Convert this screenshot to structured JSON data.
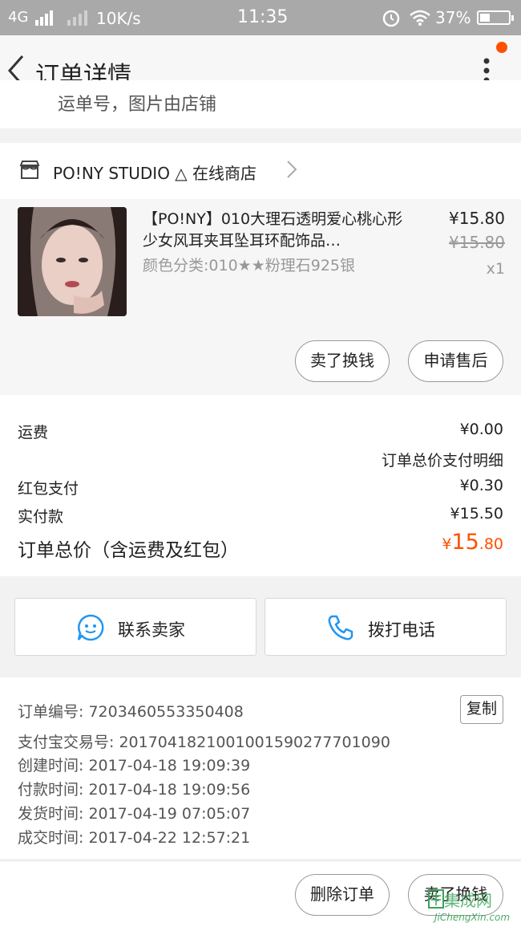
{
  "status_bar": {
    "network": "4G",
    "speed": "10K/s",
    "time": "11:35",
    "battery": "37%"
  },
  "nav": {
    "title": "订单详情"
  },
  "cutoff_text": "运单号，图片由店铺",
  "shop": {
    "name": "PO!NY STUDIO △ 在线商店"
  },
  "item": {
    "title": "【PO!NY】010大理石透明爱心桃心形少女风耳夹耳坠耳环配饰品…",
    "sku": "颜色分类:010★★粉理石925银",
    "price": "¥15.80",
    "original_price": "¥15.80",
    "quantity": "x1",
    "sell_button": "卖了换钱",
    "after_sale_button": "申请售后"
  },
  "cost": {
    "shipping_label": "运费",
    "shipping_value": "¥0.00",
    "breakdown_label": "订单总价支付明细",
    "redpacket_label": "红包支付",
    "redpacket_value": "¥0.30",
    "paid_label": "实付款",
    "paid_value": "¥15.50",
    "total_label": "订单总价（含运费及红包）",
    "total_currency": "¥",
    "total_integer": "15",
    "total_decimal": ".80",
    "accent_color": "#ff5000"
  },
  "contact": {
    "seller_label": "联系卖家",
    "phone_label": "拨打电话"
  },
  "info": {
    "order_no": "订单编号: 7203460553350408",
    "copy_button": "复制",
    "alipay_no": "支付宝交易号: 2017041821001001590277701090",
    "created": "创建时间: 2017-04-18 19:09:39",
    "paid": "付款时间: 2017-04-18 19:09:56",
    "shipped": "发货时间: 2017-04-19 07:05:07",
    "completed": "成交时间: 2017-04-22 12:57:21"
  },
  "footer": {
    "delete_button": "删除订单",
    "sell_button": "卖了换钱"
  },
  "watermark": {
    "text": "集成网",
    "url": "JiChengXin.com"
  }
}
